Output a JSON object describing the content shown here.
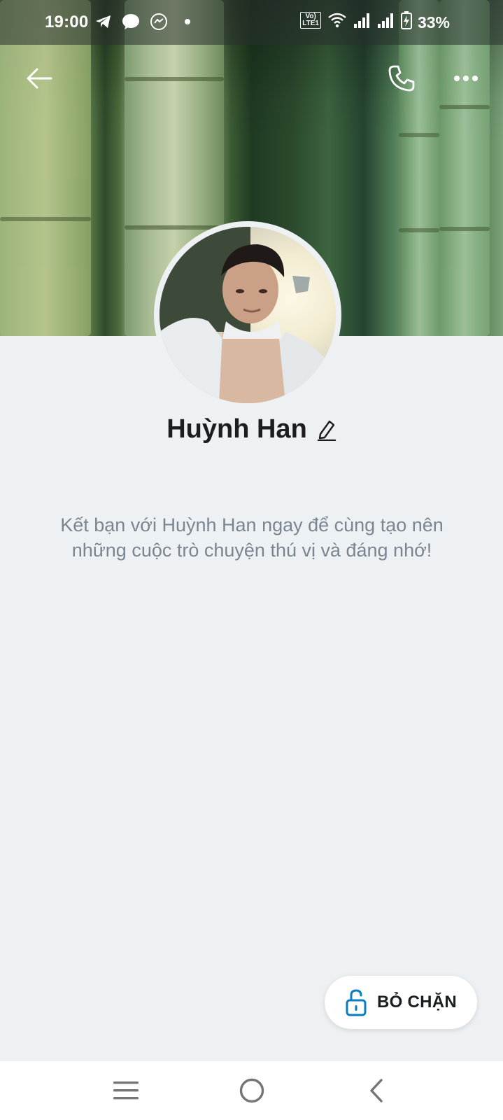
{
  "status_bar": {
    "time": "19:00",
    "battery": "33%",
    "network_badge": "LTE1",
    "icons": [
      "telegram-icon",
      "messenger-icon",
      "messenger-alt-icon",
      "dot-icon",
      "wifi-icon",
      "signal-icon",
      "signal-icon",
      "battery-charging-icon"
    ]
  },
  "header": {
    "back_icon": "arrow-left-icon",
    "call_icon": "phone-icon",
    "more_icon": "more-horizontal-icon"
  },
  "profile": {
    "name": "Huỳnh Han",
    "edit_icon": "pencil-icon",
    "message": "Kết bạn với Huỳnh Han ngay để cùng tạo nên những cuộc trò chuyện thú vị và đáng nhớ!"
  },
  "actions": {
    "unblock_label": "BỎ CHẶN",
    "unblock_icon": "unlock-icon"
  },
  "nav": {
    "icons": [
      "menu-icon",
      "home-circle-icon",
      "back-chevron-icon"
    ]
  },
  "colors": {
    "background": "#eef1f4",
    "accent_icon": "#0a7cc4",
    "text_primary": "#1b1d20",
    "text_secondary": "#7b8590"
  }
}
